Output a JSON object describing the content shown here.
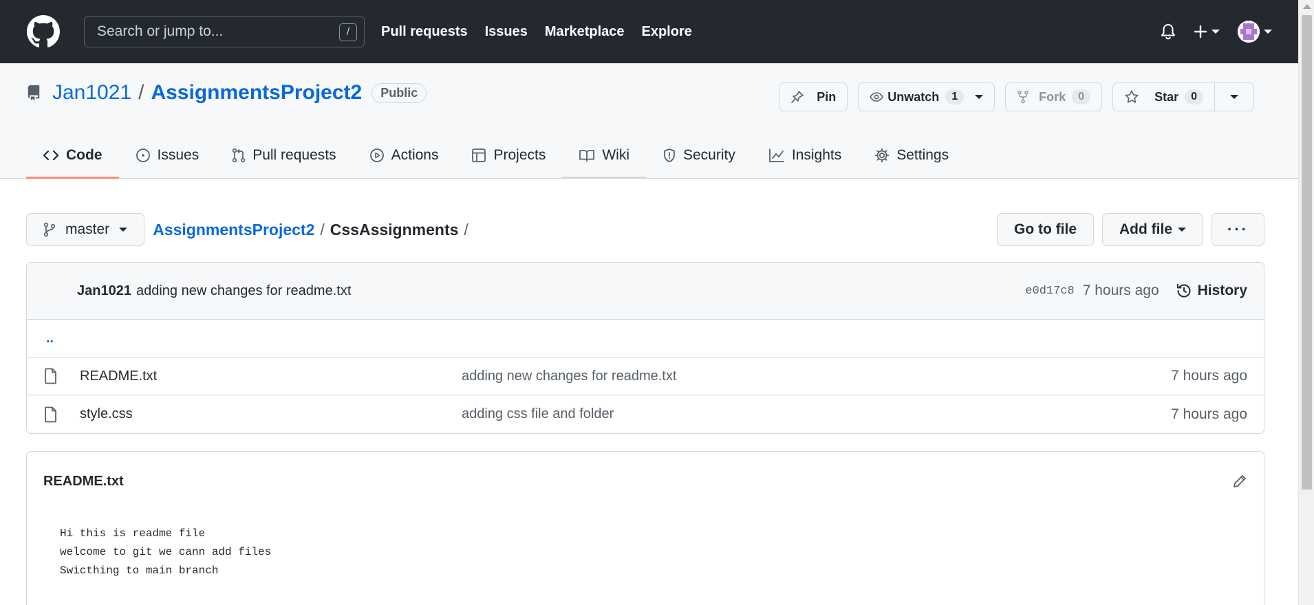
{
  "header": {
    "search_placeholder": "Search or jump to...",
    "search_shortcut": "/",
    "nav": [
      "Pull requests",
      "Issues",
      "Marketplace",
      "Explore"
    ]
  },
  "repo": {
    "owner": "Jan1021",
    "separator": "/",
    "name": "AssignmentsProject2",
    "visibility": "Public",
    "actions": {
      "pin": "Pin",
      "unwatch": "Unwatch",
      "unwatch_count": "1",
      "fork": "Fork",
      "fork_count": "0",
      "star": "Star",
      "star_count": "0"
    },
    "tabs": [
      "Code",
      "Issues",
      "Pull requests",
      "Actions",
      "Projects",
      "Wiki",
      "Security",
      "Insights",
      "Settings"
    ]
  },
  "file_nav": {
    "branch": "master",
    "breadcrumb_root": "AssignmentsProject2",
    "breadcrumb_current": "CssAssignments",
    "sep": "/",
    "go_to_file": "Go to file",
    "add_file": "Add file",
    "more": "···"
  },
  "commit": {
    "author": "Jan1021",
    "message": "adding new changes for readme.txt",
    "sha": "e0d17c8",
    "time": "7 hours ago",
    "history": "History"
  },
  "files": {
    "parent": "..",
    "items": [
      {
        "name": "README.txt",
        "message": "adding new changes for readme.txt",
        "time": "7 hours ago"
      },
      {
        "name": "style.css",
        "message": "adding css file and folder",
        "time": "7 hours ago"
      }
    ]
  },
  "readme": {
    "title": "README.txt",
    "lines": [
      "Hi this is readme file",
      "welcome to git we cann add files",
      "Swicthing to main branch"
    ]
  },
  "colors": {
    "header_bg": "#24292f",
    "link": "#0969da",
    "active_tab": "#fd8c73"
  }
}
